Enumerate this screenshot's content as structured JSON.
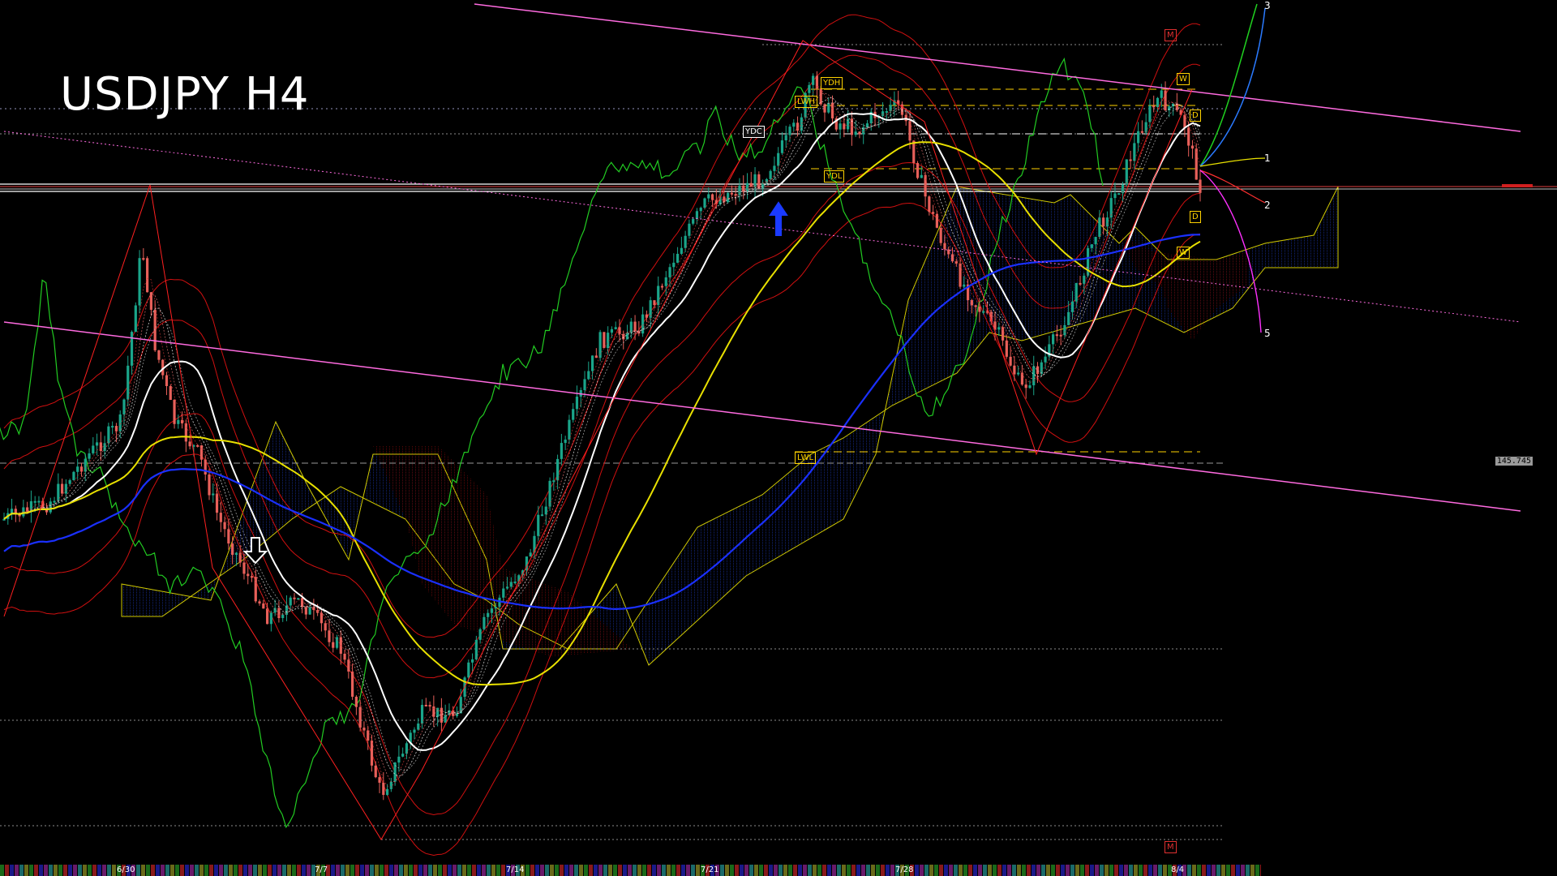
{
  "title": "USDJPY H4",
  "price_tags": {
    "current": "145.745"
  },
  "level_labels": [
    "YDC",
    "YDH",
    "LWH",
    "YDL",
    "LWL"
  ],
  "pivot_labels": [
    "W",
    "D",
    "D",
    "W",
    "M",
    "M"
  ],
  "wave_labels": [
    "1",
    "2",
    "3",
    "5"
  ],
  "colors": {
    "bull": "#1aa58a",
    "bear": "#e8605a",
    "ma_white": "#ffffff",
    "ma_yellow": "#e8e000",
    "ma_blue": "#1a30ff",
    "channel": "#ff6be0",
    "bollinger": "#d01010",
    "chikou": "#22cc22",
    "kumo_bull": "#2a50ff",
    "kumo_bear": "#c01010"
  },
  "chart_data": {
    "type": "candlestick",
    "symbol": "USDJPY",
    "timeframe": "H4",
    "x_tick_labels": [
      "6/30",
      "7/7",
      "7/14",
      "7/21",
      "7/28",
      "8/4"
    ],
    "price_label": "145.745",
    "overlays": [
      "moving-averages",
      "bollinger-bands",
      "ichimoku-cloud",
      "trend-channel",
      "pivot-levels"
    ]
  }
}
